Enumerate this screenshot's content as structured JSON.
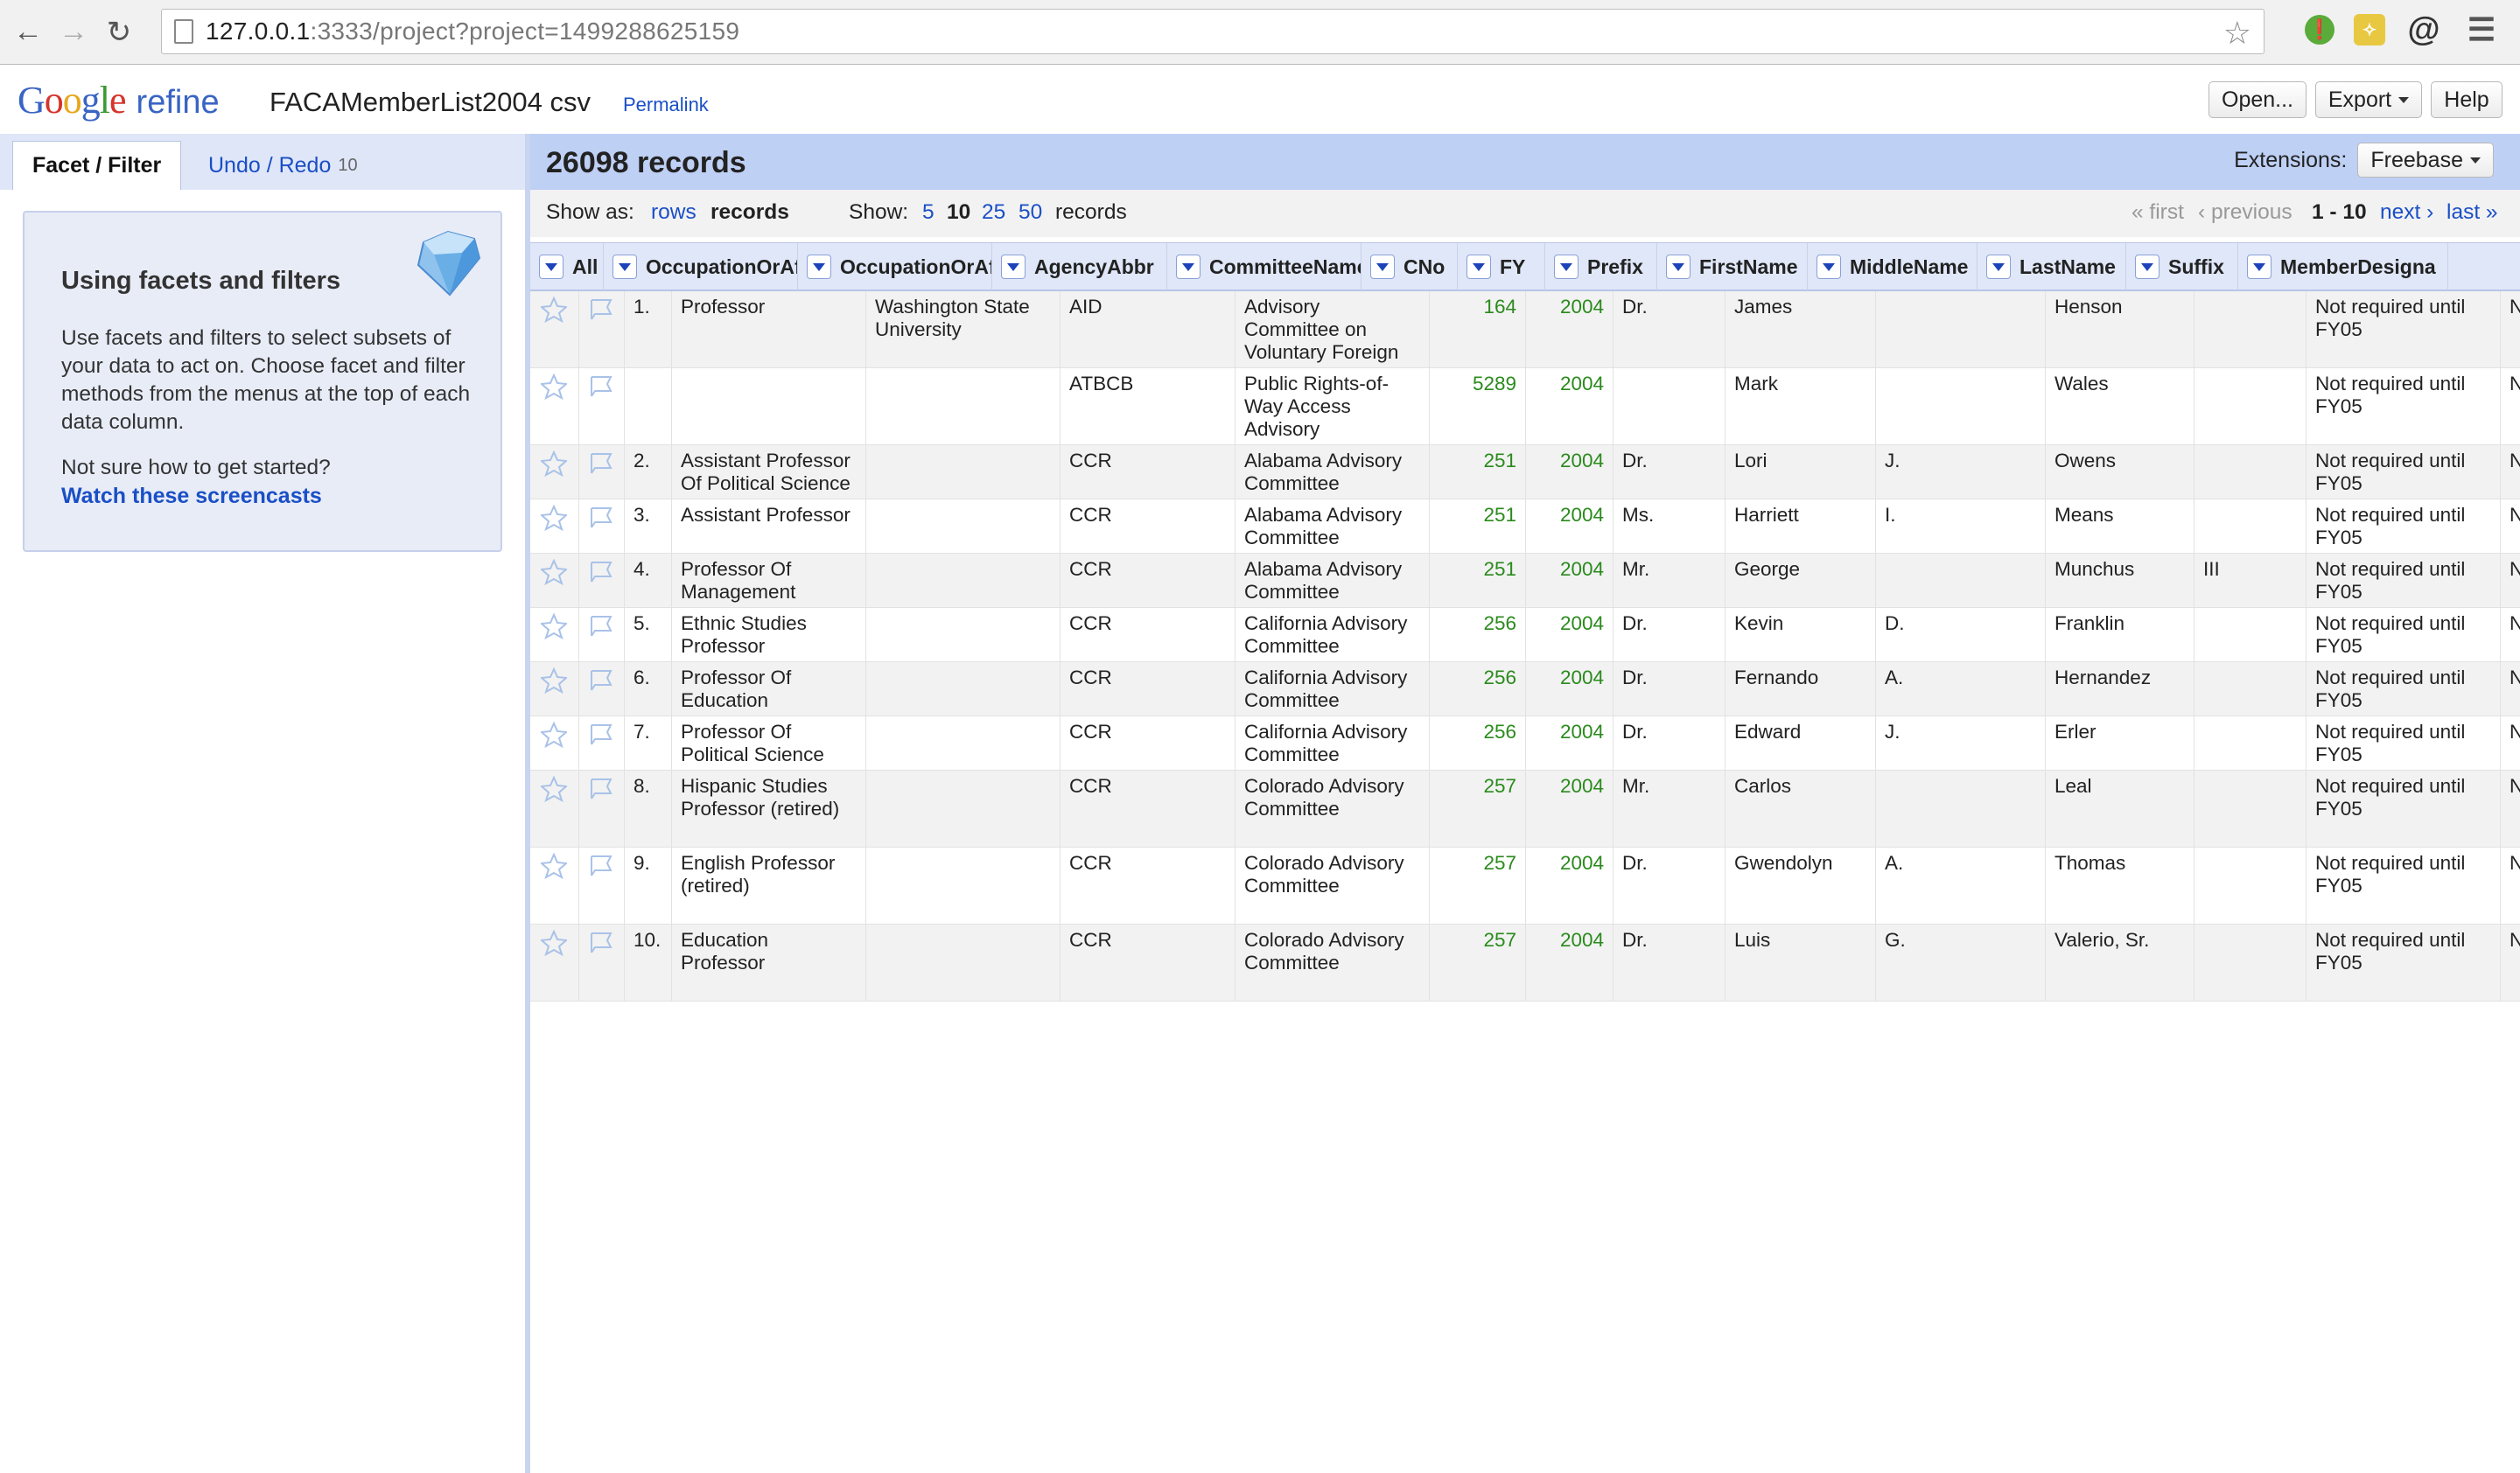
{
  "browser": {
    "url_host": "127.0.0.1",
    "url_rest": ":3333/project?project=1499288625159"
  },
  "app": {
    "logo_google": [
      "G",
      "o",
      "o",
      "g",
      "l",
      "e"
    ],
    "logo_refine": "refine",
    "project_name": "FACAMemberList2004 csv",
    "permalink": "Permalink",
    "buttons": {
      "open": "Open...",
      "export": "Export",
      "help": "Help"
    }
  },
  "left": {
    "tabs": {
      "facet": "Facet / Filter",
      "undo": "Undo / Redo",
      "undo_count": "10"
    },
    "help": {
      "title": "Using facets and filters",
      "text": "Use facets and filters to select subsets of your data to act on. Choose facet and filter methods from the menus at the top of each data column.",
      "question": "Not sure how to get started?",
      "link": "Watch these screencasts"
    }
  },
  "right": {
    "records_count": "26098 records",
    "extensions_label": "Extensions:",
    "extensions_value": "Freebase",
    "show_as_label": "Show as:",
    "show_as_rows": "rows",
    "show_as_records": "records",
    "show_label": "Show:",
    "show_options": [
      "5",
      "10",
      "25",
      "50"
    ],
    "show_suffix": "records",
    "pager": {
      "first": "« first",
      "previous": "‹ previous",
      "range": "1 - 10",
      "next": "next ›",
      "last": "last »"
    }
  },
  "table": {
    "columns": [
      "All",
      "OccupationOrAf",
      "OccupationOrAf",
      "AgencyAbbr",
      "CommitteeName",
      "CNo",
      "FY",
      "Prefix",
      "FirstName",
      "MiddleName",
      "LastName",
      "Suffix",
      "MemberDesigna"
    ],
    "rows": [
      {
        "n": "1.",
        "occ1": "Professor",
        "occ2": "Washington State University",
        "agency": "AID",
        "committee": "Advisory Committee on Voluntary Foreign Aid",
        "cno": "164",
        "fy": "2004",
        "prefix": "Dr.",
        "first": "James",
        "middle": "",
        "last": "Henson",
        "suffix": "",
        "member": "Not required until FY05",
        "extra": "No"
      },
      {
        "n": "",
        "occ1": "",
        "occ2": "",
        "agency": "ATBCB",
        "committee": "Public Rights-of-Way Access Advisory Committee",
        "cno": "5289",
        "fy": "2004",
        "prefix": "",
        "first": "Mark",
        "middle": "",
        "last": "Wales",
        "suffix": "",
        "member": "Not required until FY05",
        "extra": "No"
      },
      {
        "n": "2.",
        "occ1": "Assistant Professor Of Political Science",
        "occ2": "",
        "agency": "CCR",
        "committee": "Alabama Advisory Committee",
        "cno": "251",
        "fy": "2004",
        "prefix": "Dr.",
        "first": "Lori",
        "middle": "J.",
        "last": "Owens",
        "suffix": "",
        "member": "Not required until FY05",
        "extra": "No"
      },
      {
        "n": "3.",
        "occ1": "Assistant Professor",
        "occ2": "",
        "agency": "CCR",
        "committee": "Alabama Advisory Committee",
        "cno": "251",
        "fy": "2004",
        "prefix": "Ms.",
        "first": "Harriett",
        "middle": "I.",
        "last": "Means",
        "suffix": "",
        "member": "Not required until FY05",
        "extra": "No"
      },
      {
        "n": "4.",
        "occ1": "Professor Of Management",
        "occ2": "",
        "agency": "CCR",
        "committee": "Alabama Advisory Committee",
        "cno": "251",
        "fy": "2004",
        "prefix": "Mr.",
        "first": "George",
        "middle": "",
        "last": "Munchus",
        "suffix": "III",
        "member": "Not required until FY05",
        "extra": "No"
      },
      {
        "n": "5.",
        "occ1": "Ethnic Studies Professor",
        "occ2": "",
        "agency": "CCR",
        "committee": "California Advisory Committee",
        "cno": "256",
        "fy": "2004",
        "prefix": "Dr.",
        "first": "Kevin",
        "middle": "D.",
        "last": "Franklin",
        "suffix": "",
        "member": "Not required until FY05",
        "extra": "No"
      },
      {
        "n": "6.",
        "occ1": "Professor Of Education",
        "occ2": "",
        "agency": "CCR",
        "committee": "California Advisory Committee",
        "cno": "256",
        "fy": "2004",
        "prefix": "Dr.",
        "first": "Fernando",
        "middle": "A.",
        "last": "Hernandez",
        "suffix": "",
        "member": "Not required until FY05",
        "extra": "No"
      },
      {
        "n": "7.",
        "occ1": "Professor Of Political Science",
        "occ2": "",
        "agency": "CCR",
        "committee": "California Advisory Committee",
        "cno": "256",
        "fy": "2004",
        "prefix": "Dr.",
        "first": "Edward",
        "middle": "J.",
        "last": "Erler",
        "suffix": "",
        "member": "Not required until FY05",
        "extra": "No"
      },
      {
        "n": "8.",
        "occ1": "Hispanic Studies Professor (retired)",
        "occ2": "",
        "agency": "CCR",
        "committee": "Colorado Advisory Committee",
        "cno": "257",
        "fy": "2004",
        "prefix": "Mr.",
        "first": "Carlos",
        "middle": "",
        "last": "Leal",
        "suffix": "",
        "member": "Not required until FY05",
        "extra": "No"
      },
      {
        "n": "9.",
        "occ1": "English Professor (retired)",
        "occ2": "",
        "agency": "CCR",
        "committee": "Colorado Advisory Committee",
        "cno": "257",
        "fy": "2004",
        "prefix": "Dr.",
        "first": "Gwendolyn",
        "middle": "A.",
        "last": "Thomas",
        "suffix": "",
        "member": "Not required until FY05",
        "extra": "No"
      },
      {
        "n": "10.",
        "occ1": "Education Professor",
        "occ2": "",
        "agency": "CCR",
        "committee": "Colorado Advisory Committee",
        "cno": "257",
        "fy": "2004",
        "prefix": "Dr.",
        "first": "Luis",
        "middle": "G.",
        "last": "Valerio, Sr.",
        "suffix": "",
        "member": "Not required until FY05",
        "extra": "No"
      }
    ]
  },
  "colors": {
    "link": "#1a4fc6",
    "number": "#2a8a1c",
    "header_band": "#bfd0f5",
    "column_header": "#dfe7f8"
  }
}
